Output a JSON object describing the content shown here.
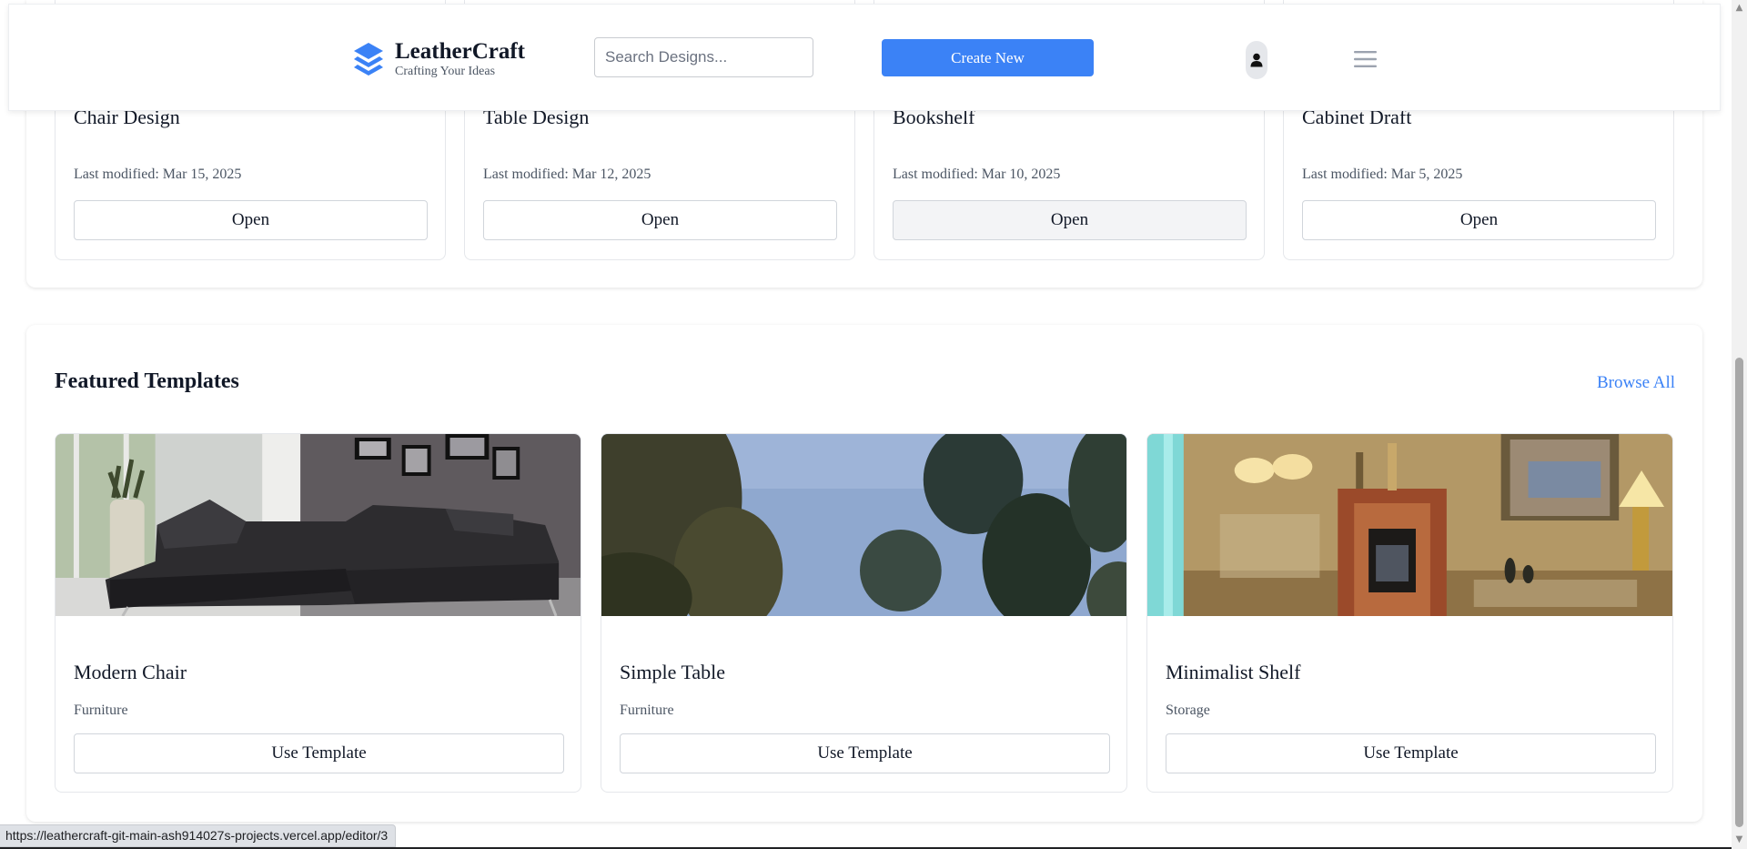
{
  "header": {
    "brand": "LeatherCraft",
    "tagline": "Crafting Your Ideas",
    "search_placeholder": "Search Designs...",
    "create_label": "Create New",
    "accent_color": "#3b82f6"
  },
  "recent_designs": [
    {
      "title": "Chair Design",
      "modified": "Last modified: Mar 15, 2025",
      "action": "Open"
    },
    {
      "title": "Table Design",
      "modified": "Last modified: Mar 12, 2025",
      "action": "Open"
    },
    {
      "title": "Bookshelf",
      "modified": "Last modified: Mar 10, 2025",
      "action": "Open"
    },
    {
      "title": "Cabinet Draft",
      "modified": "Last modified: Mar 5, 2025",
      "action": "Open"
    }
  ],
  "featured": {
    "title": "Featured Templates",
    "browse_label": "Browse All",
    "templates": [
      {
        "name": "Modern Chair",
        "category": "Furniture",
        "action": "Use Template",
        "image": "sofa-photo"
      },
      {
        "name": "Simple Table",
        "category": "Furniture",
        "action": "Use Template",
        "image": "tree-sky-photo"
      },
      {
        "name": "Minimalist Shelf",
        "category": "Storage",
        "action": "Use Template",
        "image": "living-room-photo"
      }
    ]
  },
  "status_bar": {
    "url": "https://leathercraft-git-main-ash914027s-projects.vercel.app/editor/3"
  }
}
